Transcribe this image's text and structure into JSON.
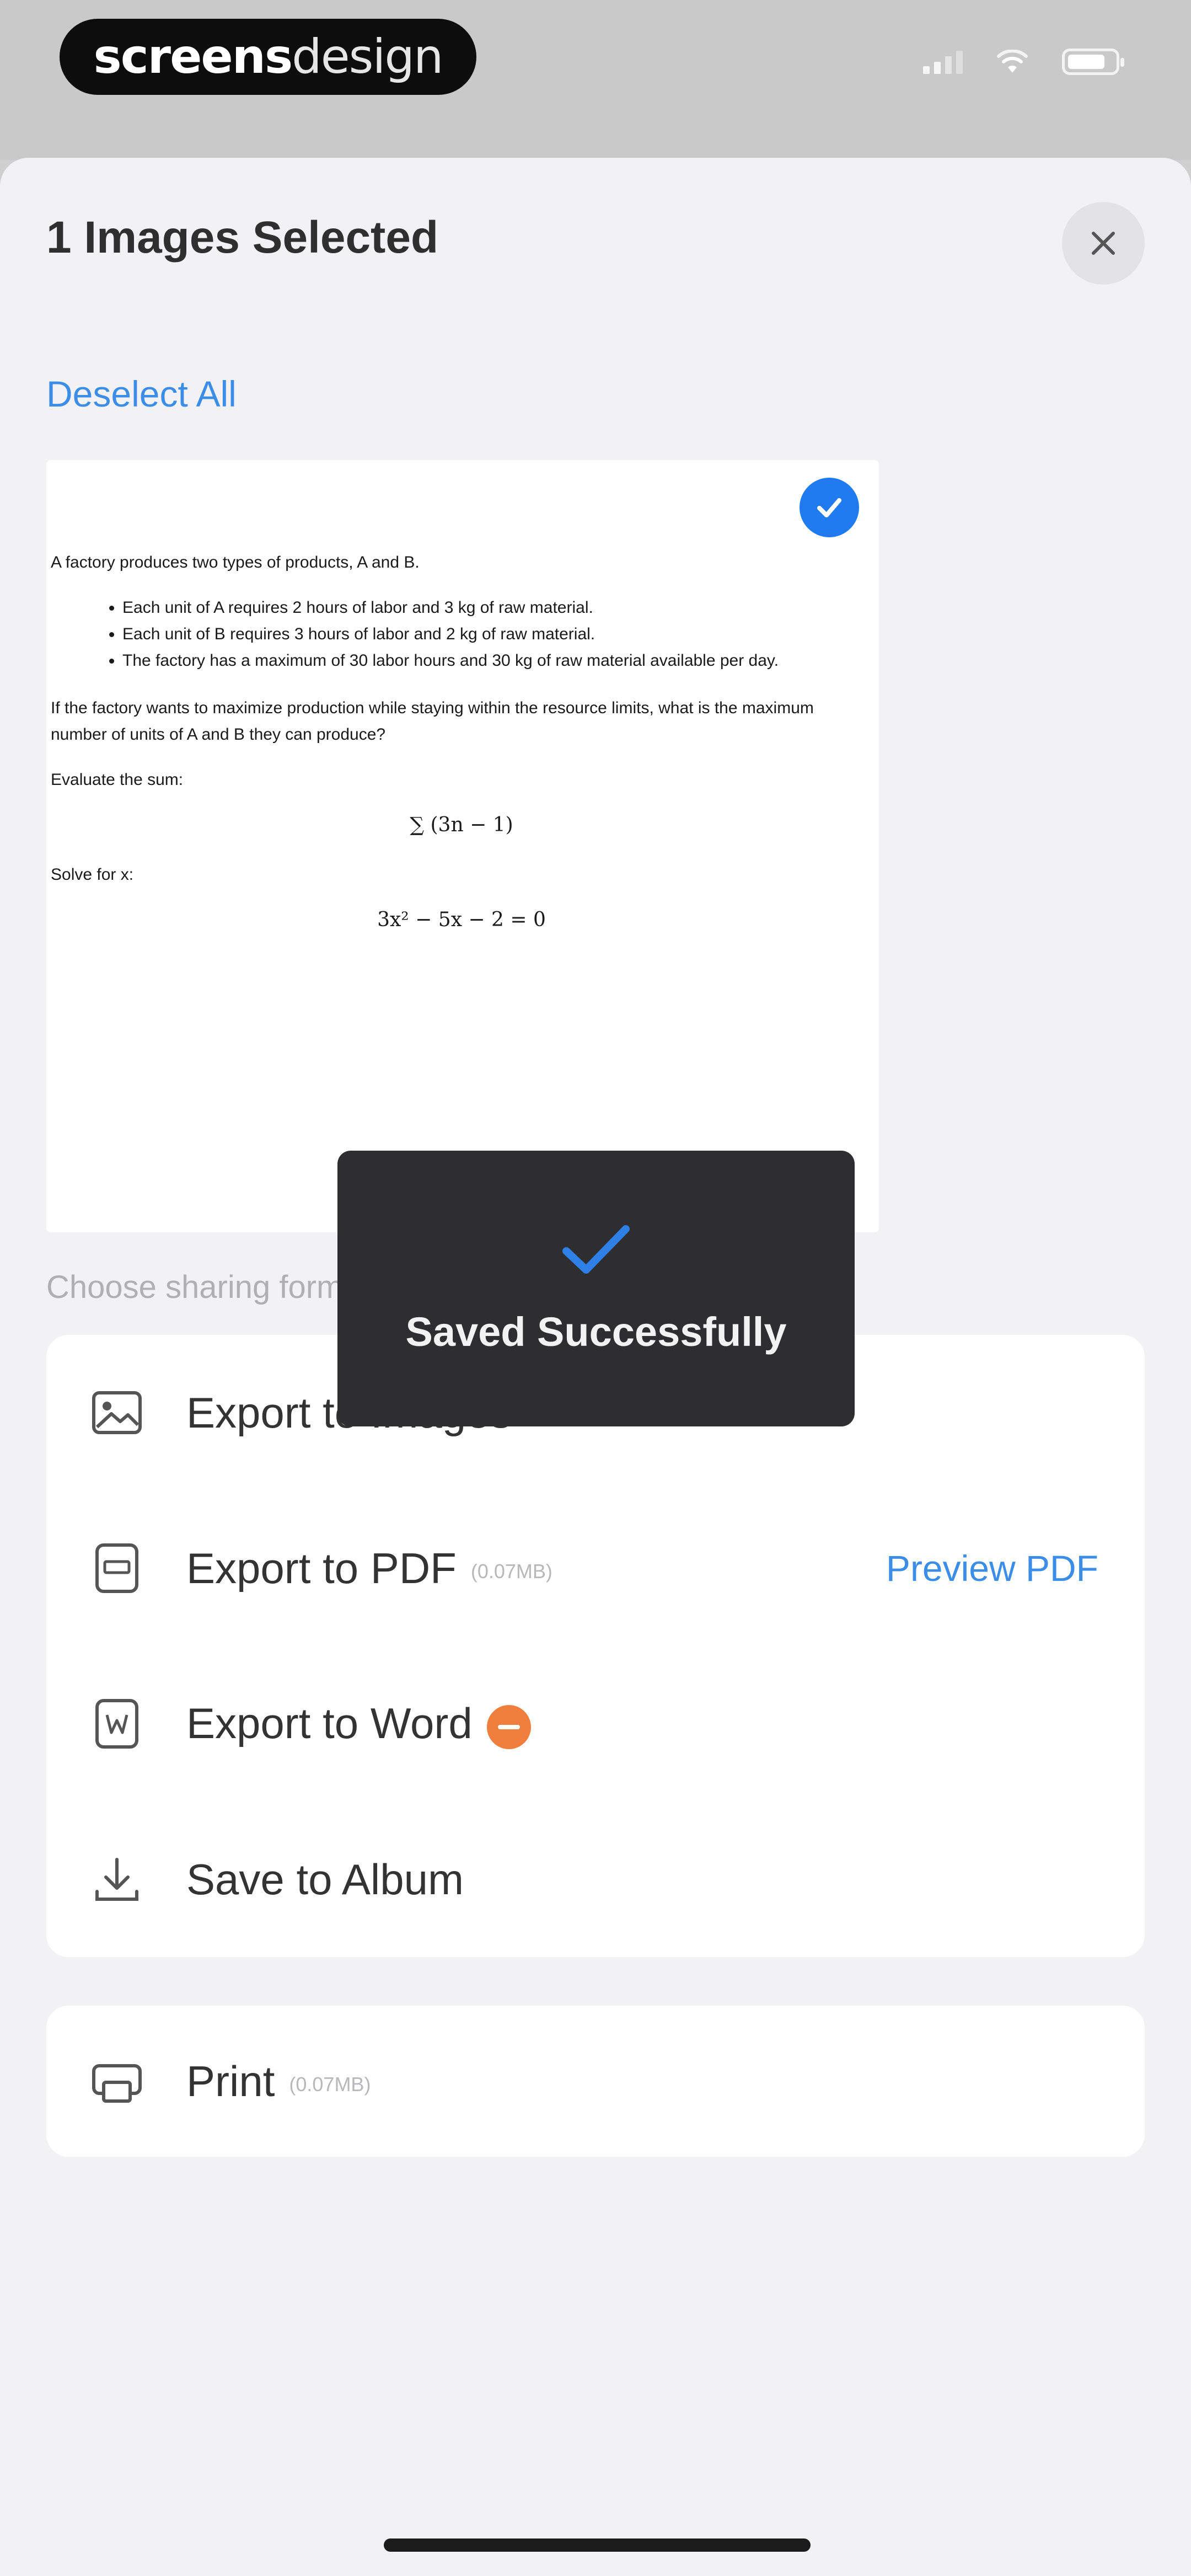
{
  "status_bar": {
    "brand_part1": "screens",
    "brand_part2": "design"
  },
  "sheet": {
    "title": "1 Images Selected",
    "deselect_label": "Deselect All",
    "choose_format_label": "Choose sharing format",
    "close_icon": "close-icon"
  },
  "document_preview": {
    "intro": "A factory produces two types of products, A and B.",
    "bullets": [
      "Each unit of A requires 2 hours of labor and 3 kg of raw material.",
      "Each unit of B requires 3 hours of labor and 2 kg of raw material.",
      "The factory has a maximum of 30 labor hours and 30 kg of raw material available per day."
    ],
    "question": "If the factory wants to maximize production while staying within the resource limits, what is the maximum number of units of A and B they can produce?",
    "evaluate_label": "Evaluate the sum:",
    "sum_expression": "∑ (3n − 1)",
    "solve_label": "Solve for x:",
    "equation": "3x² − 5x − 2 = 0"
  },
  "options": [
    {
      "label": "Export to Images",
      "icon": "image-icon",
      "size": ""
    },
    {
      "label": "Export to PDF",
      "icon": "pdf-icon",
      "size": "(0.07MB)",
      "action": "Preview PDF"
    },
    {
      "label": "Export to Word",
      "icon": "word-icon",
      "size": ""
    },
    {
      "label": "Save to Album",
      "icon": "download-icon",
      "size": ""
    }
  ],
  "print": {
    "label": "Print",
    "size": "(0.07MB)",
    "icon": "print-icon"
  },
  "toast": {
    "message": "Saved Successfully",
    "icon": "checkmark-icon"
  },
  "colors": {
    "accent": "#3b8de8",
    "check_badge": "#1f7bef",
    "word_badge": "#f07f3e",
    "toast_bg": "#2e2e30"
  }
}
